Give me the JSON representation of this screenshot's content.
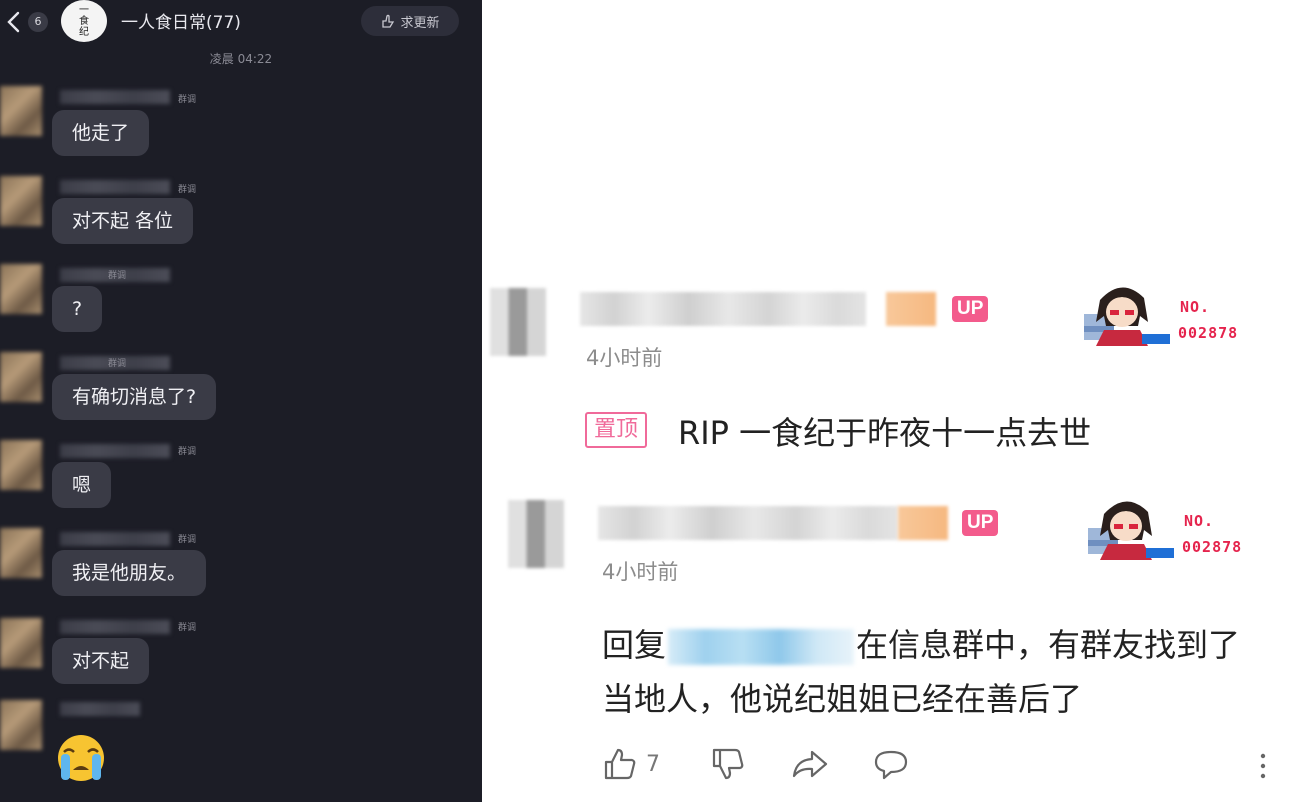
{
  "chat": {
    "back_icon": "chevron-left-icon",
    "unread_count": "6",
    "group_avatar_text": [
      "一",
      "食",
      "纪"
    ],
    "group_title": "一人食日常(77)",
    "request_update_label": "求更新",
    "timestamp": "凌晨 04:22",
    "member_role": "群调",
    "messages": [
      {
        "text": "他走了"
      },
      {
        "text": "对不起 各位"
      },
      {
        "text": "?"
      },
      {
        "text": "有确切消息了?"
      },
      {
        "text": "嗯"
      },
      {
        "text": "我是他朋友。"
      },
      {
        "text": "对不起"
      },
      {
        "text": "😭"
      }
    ]
  },
  "comments": [
    {
      "up_badge": "UP",
      "time": "4小时前",
      "pinned_label": "置顶",
      "text": "RIP 一食纪于昨夜十一点去世",
      "fan_no_label": "NO.",
      "fan_no": "002878"
    },
    {
      "up_badge": "UP",
      "time": "4小时前",
      "reply_prefix": "回复",
      "text_line1": "在信息群中，有群友找到了",
      "text_line2": "当地人，他说纪姐姐已经在善后了",
      "fan_no_label": "NO.",
      "fan_no": "002878"
    }
  ],
  "actions": {
    "like_count": "7",
    "icons": [
      "thumbs-up-icon",
      "thumbs-down-icon",
      "share-icon",
      "comment-icon",
      "more-icon"
    ]
  },
  "colors": {
    "chat_bg": "#1c1d26",
    "bubble_bg": "#3a3b46",
    "up_badge": "#f35b8c",
    "pin_accent": "#f06a9a",
    "fan_no": "#e5244d"
  }
}
